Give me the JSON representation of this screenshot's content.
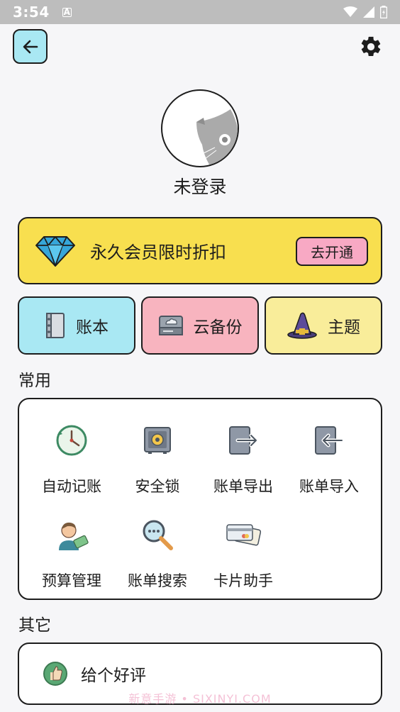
{
  "status_bar": {
    "time": "3:54",
    "notification_icon": "A"
  },
  "header": {
    "back_icon": "arrow-left-icon",
    "settings_icon": "gear-icon"
  },
  "profile": {
    "username": "未登录"
  },
  "vip": {
    "text": "永久会员限时折扣",
    "button": "去开通"
  },
  "quick_cards": [
    {
      "label": "账本",
      "icon": "ledger-book-icon",
      "color": "#a9e8f3"
    },
    {
      "label": "云备份",
      "icon": "cloud-backup-icon",
      "color": "#f8b4bf"
    },
    {
      "label": "主题",
      "icon": "wizard-hat-icon",
      "color": "#f9ed9a"
    }
  ],
  "common": {
    "title": "常用",
    "items": [
      {
        "label": "自动记账",
        "icon": "auto-clock-icon"
      },
      {
        "label": "安全锁",
        "icon": "safe-lock-icon"
      },
      {
        "label": "账单导出",
        "icon": "export-icon"
      },
      {
        "label": "账单导入",
        "icon": "import-icon"
      },
      {
        "label": "预算管理",
        "icon": "budget-person-icon"
      },
      {
        "label": "账单搜索",
        "icon": "search-magnifier-icon"
      },
      {
        "label": "卡片助手",
        "icon": "cards-icon"
      }
    ]
  },
  "other": {
    "title": "其它",
    "items": [
      {
        "label": "给个好评",
        "icon": "thumbs-up-icon"
      }
    ]
  },
  "watermark": "新意手游 • SIXINYI.COM",
  "colors": {
    "accent_yellow": "#f8df4f",
    "button_pink": "#f8a9c4",
    "cyan": "#a9e8f3"
  }
}
